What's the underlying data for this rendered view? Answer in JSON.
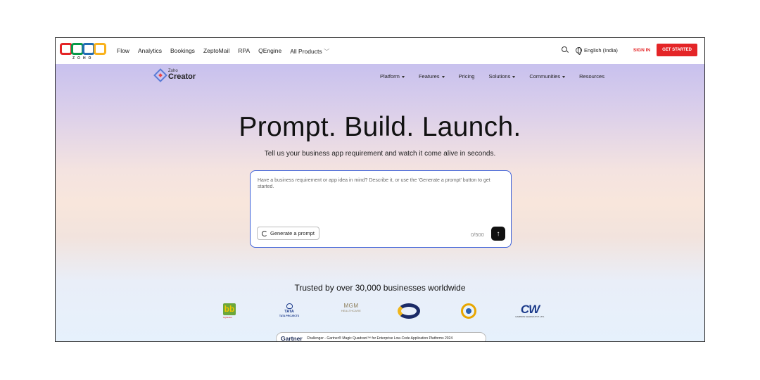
{
  "zoho_bar": {
    "logo_text": "ZOHO",
    "nav": [
      "Flow",
      "Analytics",
      "Bookings",
      "ZeptoMail",
      "RPA",
      "QEngine",
      "All Products"
    ],
    "language": "English (India)",
    "sign_in": "SIGN IN",
    "get_started": "GET STARTED"
  },
  "creator_header": {
    "logo_small": "Zoho",
    "logo_big": "Creator",
    "nav": [
      {
        "label": "Platform",
        "dropdown": true
      },
      {
        "label": "Features",
        "dropdown": true
      },
      {
        "label": "Pricing",
        "dropdown": false
      },
      {
        "label": "Solutions",
        "dropdown": true
      },
      {
        "label": "Communities",
        "dropdown": true
      },
      {
        "label": "Resources",
        "dropdown": false
      }
    ]
  },
  "hero": {
    "headline": "Prompt. Build. Launch.",
    "subline": "Tell us your business app requirement and watch it come alive in seconds."
  },
  "prompt": {
    "placeholder": "Have a business requirement or app idea in mind? Describe it, or use the 'Generate a prompt' button to get started.",
    "generate_label": "Generate a prompt",
    "counter": "0/500",
    "send_icon": "arrow-up-icon"
  },
  "trusted": {
    "title": "Trusted by over 30,000 businesses worldwide",
    "logos": {
      "bb": "bb",
      "bb_caption": "bigbasket",
      "tata_top": "TATA",
      "tata_bottom": "TATA PROJECTS",
      "mgm": "MGM",
      "mgm_sub": "HEALTHCARE",
      "cw": "CW",
      "cw_sub": "GAMMON SHAWLS PVT. LTD."
    }
  },
  "gartner": {
    "name": "Gartner",
    "text": "Challenger - Gartner® Magic Quadrant™ for Enterprise Low-Code Application Platforms 2024"
  },
  "colors": {
    "accent_red": "#e42527",
    "prompt_border": "#3a5fd9",
    "zoho_squares": [
      "#e42527",
      "#089949",
      "#226db4",
      "#f9b21d"
    ]
  }
}
